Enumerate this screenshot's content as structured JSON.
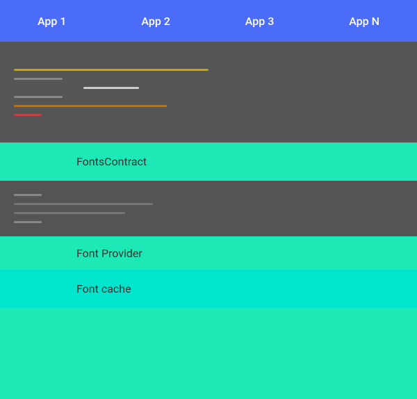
{
  "topBar": {
    "apps": [
      "App 1",
      "App 2",
      "App 3",
      "App N"
    ]
  },
  "sections": {
    "fontsContract": {
      "label": "FontsContract"
    },
    "fontProvider": {
      "label": "Font Provider"
    },
    "fontCache": {
      "label": "Font cache"
    }
  },
  "colors": {
    "topBar": "#4a6cf7",
    "darkSection": "#555555",
    "tealMain": "#1de9b6",
    "tealAlt": "#00e5cc"
  }
}
